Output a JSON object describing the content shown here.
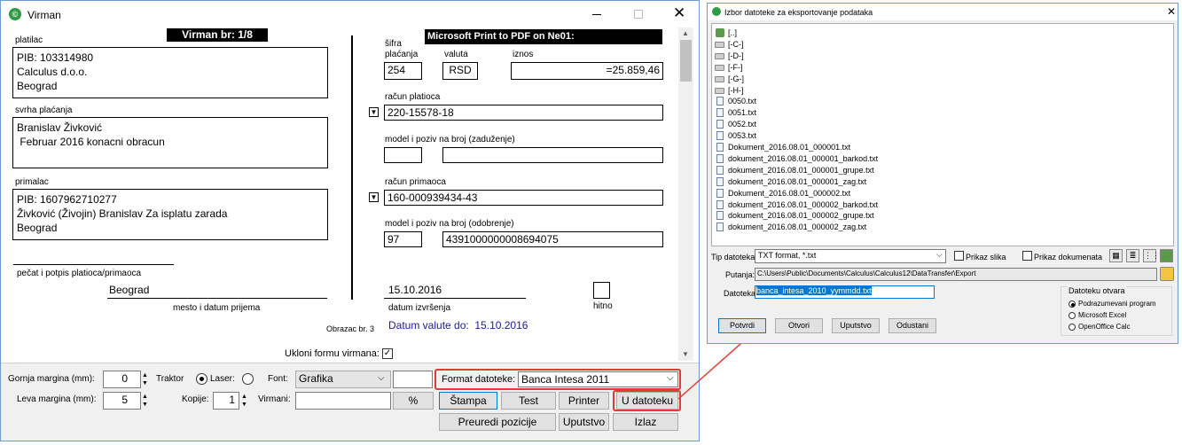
{
  "left": {
    "title": "Virman",
    "header_label": "Virman br: 1/8",
    "printer_bar": "Microsoft Print to PDF on Ne01:",
    "platilac": {
      "label": "platilac",
      "l1": "PIB: 103314980",
      "l2": "Calculus d.o.o.",
      "l3": "Beograd"
    },
    "svrha": {
      "label": "svrha plaćanja",
      "l1": "Branislav Živković",
      "l2": " Februar 2016 konacni obracun"
    },
    "primalac": {
      "label": "primalac",
      "l1": "PIB: 1607962710277",
      "l2": "Živković (Živojin) Branislav Za isplatu zarada",
      "l3": "Beograd"
    },
    "pecat_label": "pečat i potpis platioca/primaoca",
    "mesto_value": "Beograd",
    "mesto_label": "mesto i datum prijema",
    "obrazac": "Obrazac br. 3",
    "sifra_label_1": "šifra",
    "sifra_label_2": "plaćanja",
    "valuta_label": "valuta",
    "iznos_label": "iznos",
    "sifra_value": "254",
    "valuta_value": "RSD",
    "iznos_value": "=25.859,46",
    "racun_platioca_label": "račun platioca",
    "racun_platioca_value": "220-15578-18",
    "model_zaduzenje_label": "model i poziv na broj (zaduženje)",
    "racun_primaoca_label": "račun primaoca",
    "racun_primaoca_value": "160-000939434-43",
    "model_odobrenje_label": "model i poziv na broj (odobrenje)",
    "model_value": "97",
    "poziv_value": "4391000000008694075",
    "datum_izvrsenja_value": "15.10.2016",
    "datum_izvrsenja_label": "datum izvršenja",
    "hitno_label": "hitno",
    "datum_valute": "Datum valute do:  15.10.2016",
    "ukloni_label": "Ukloni formu virmana:",
    "ukloni_checked": true
  },
  "controls": {
    "gornja_label": "Gornja margina (mm):",
    "gornja_value": "0",
    "leva_label": "Leva margina (mm):",
    "leva_value": "5",
    "traktor_label": "Traktor",
    "laser_label": "Laser:",
    "kopije_label": "Kopije:",
    "kopije_value": "1",
    "font_label": "Font:",
    "font_value": "Grafika",
    "virmani_label": "Virmani:",
    "percent_btn": "%",
    "format_label": "Format datoteke:",
    "format_value": "Banca Intesa 2011",
    "stampa_btn": "Štampa",
    "test_btn": "Test",
    "printer_btn": "Printer",
    "udatoteku_btn": "U datoteku",
    "preuredi_btn": "Preuredi pozicije",
    "uputstvo_btn": "Uputstvo",
    "izlaz_btn": "Izlaz"
  },
  "right": {
    "title": "Izbor datoteke za eksportovanje podataka",
    "files": [
      "[..]",
      "[-C-]",
      "[-D-]",
      "[-F-]",
      "[-G-]",
      "[-H-]",
      "0050.txt",
      "0051.txt",
      "0052.txt",
      "0053.txt",
      "Dokument_2016.08.01_000001.txt",
      "dokument_2016.08.01_000001_barkod.txt",
      "dokument_2016.08.01_000001_grupe.txt",
      "dokument_2016.08.01_000001_zag.txt",
      "Dokument_2016.08.01_000002.txt",
      "dokument_2016.08.01_000002_barkod.txt",
      "dokument_2016.08.01_000002_grupe.txt",
      "dokument_2016.08.01_000002_zag.txt"
    ],
    "tip_label": "Tip datoteka:",
    "tip_value": "TXT format, *.txt",
    "prikaz_slika": "Prikaz slika",
    "prikaz_dokumenata": "Prikaz dokumenata",
    "putanja_label": "Putanja:",
    "putanja_value": "C:\\Users\\Public\\Documents\\Calculus\\Calculus12\\DataTransfer\\Export",
    "datoteka_label": "Datoteka:",
    "datoteka_value": "banca_intesa_2010_yymmdd.txt",
    "otvara_label": "Datoteku otvara",
    "opt1": "Podrazumevani program",
    "opt2": "Microsoft Excel",
    "opt3": "OpenOffice Calc",
    "potvrdi": "Potvrdi",
    "otvori": "Otvori",
    "uputstvo": "Uputstvo",
    "odustani": "Odustani"
  },
  "colors": {
    "accent": "#0078d7",
    "highlight": "#e03c31",
    "blue_text": "#1a1aa6"
  }
}
